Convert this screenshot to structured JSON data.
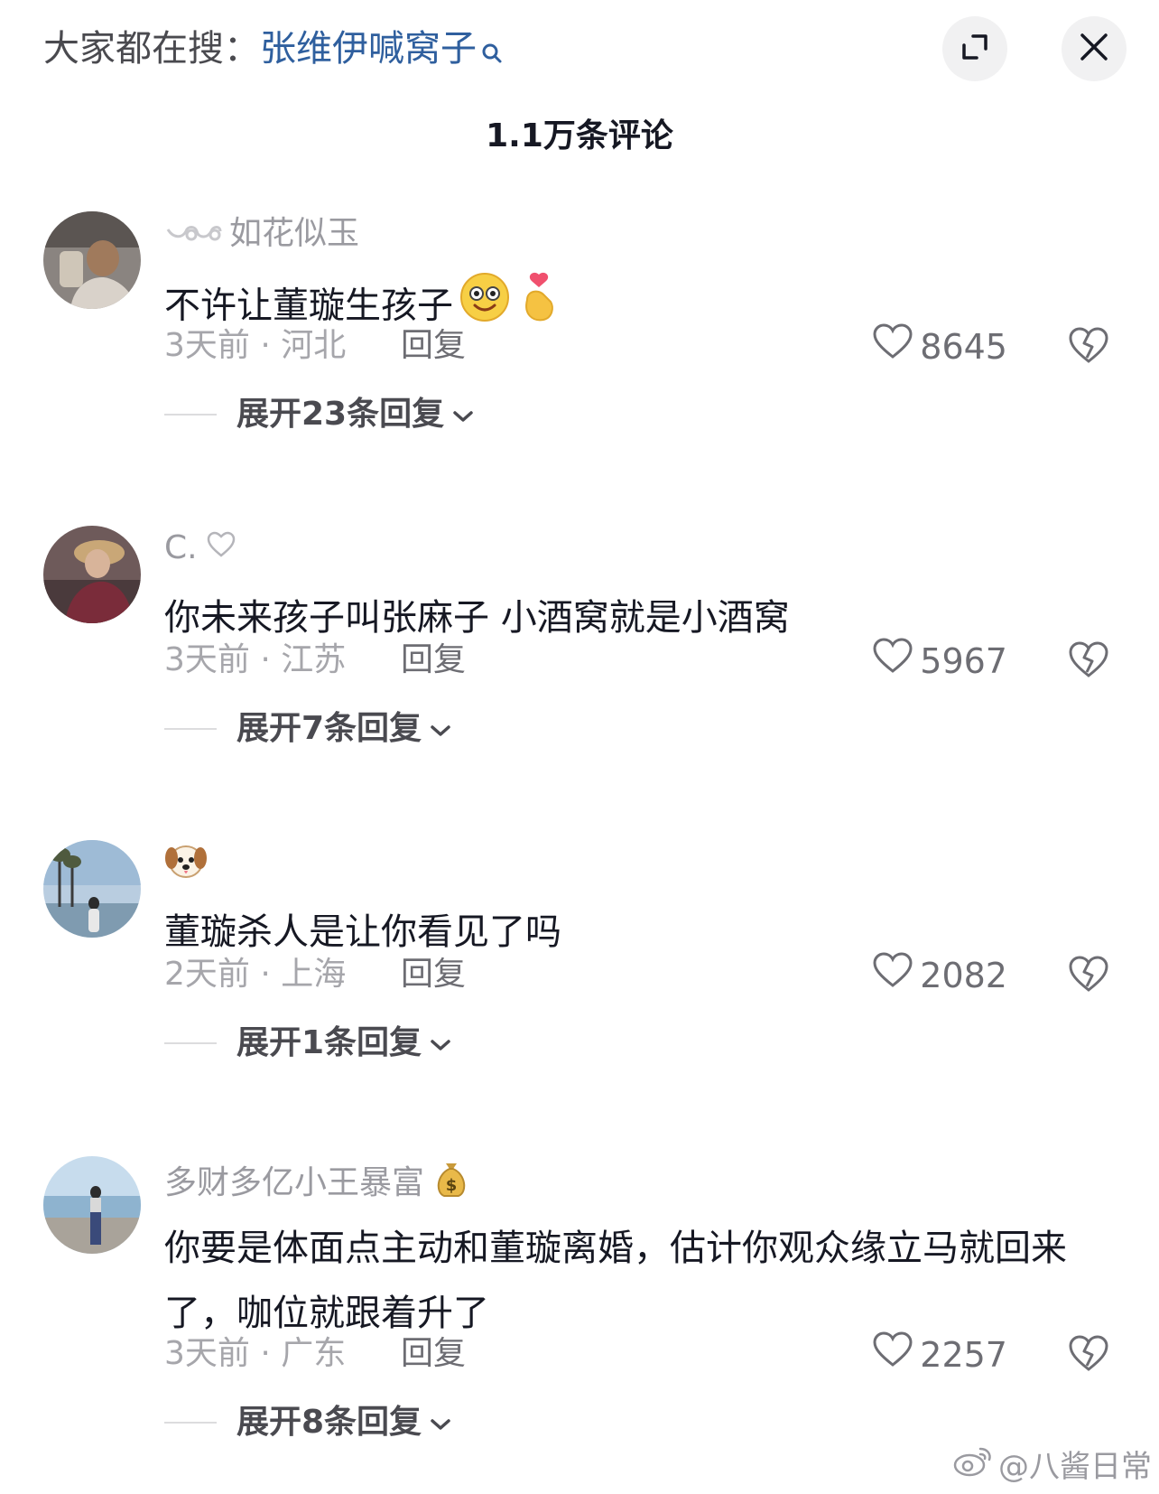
{
  "header": {
    "hot_search_prefix": "大家都在搜：",
    "hot_search_term": "张维伊喊窝子",
    "comment_count": "1.1万条评论"
  },
  "comments": [
    {
      "username": "如花似玉",
      "text": "不许让董璇生孩子",
      "time_location": "3天前 · 河北",
      "reply_label": "回复",
      "likes": "8645",
      "expand_label": "展开23条回复"
    },
    {
      "username": "C.",
      "text": "你未来孩子叫张麻子 小酒窝就是小酒窝",
      "time_location": "3天前 · 江苏",
      "reply_label": "回复",
      "likes": "5967",
      "expand_label": "展开7条回复"
    },
    {
      "username": "",
      "text": "董璇杀人是让你看见了吗",
      "time_location": "2天前 · 上海",
      "reply_label": "回复",
      "likes": "2082",
      "expand_label": "展开1条回复"
    },
    {
      "username": "多财多亿小王暴富",
      "text": "你要是体面点主动和董璇离婚，估计你观众缘立马就回来了，咖位就跟着升了",
      "time_location": "3天前 · 广东",
      "reply_label": "回复",
      "likes": "2257",
      "expand_label": "展开8条回复"
    }
  ],
  "watermark": {
    "text": "@八酱日常"
  },
  "colors": {
    "hot_search_term": "#2f5f9e",
    "secondary_text": "#a6a6ab",
    "primary_text": "#161823",
    "button_bg": "#f1f1f2"
  },
  "icons": [
    "search-icon",
    "expand-icon",
    "close-icon",
    "heart-icon",
    "dislike-icon",
    "chevron-down-icon",
    "weibo-icon"
  ]
}
